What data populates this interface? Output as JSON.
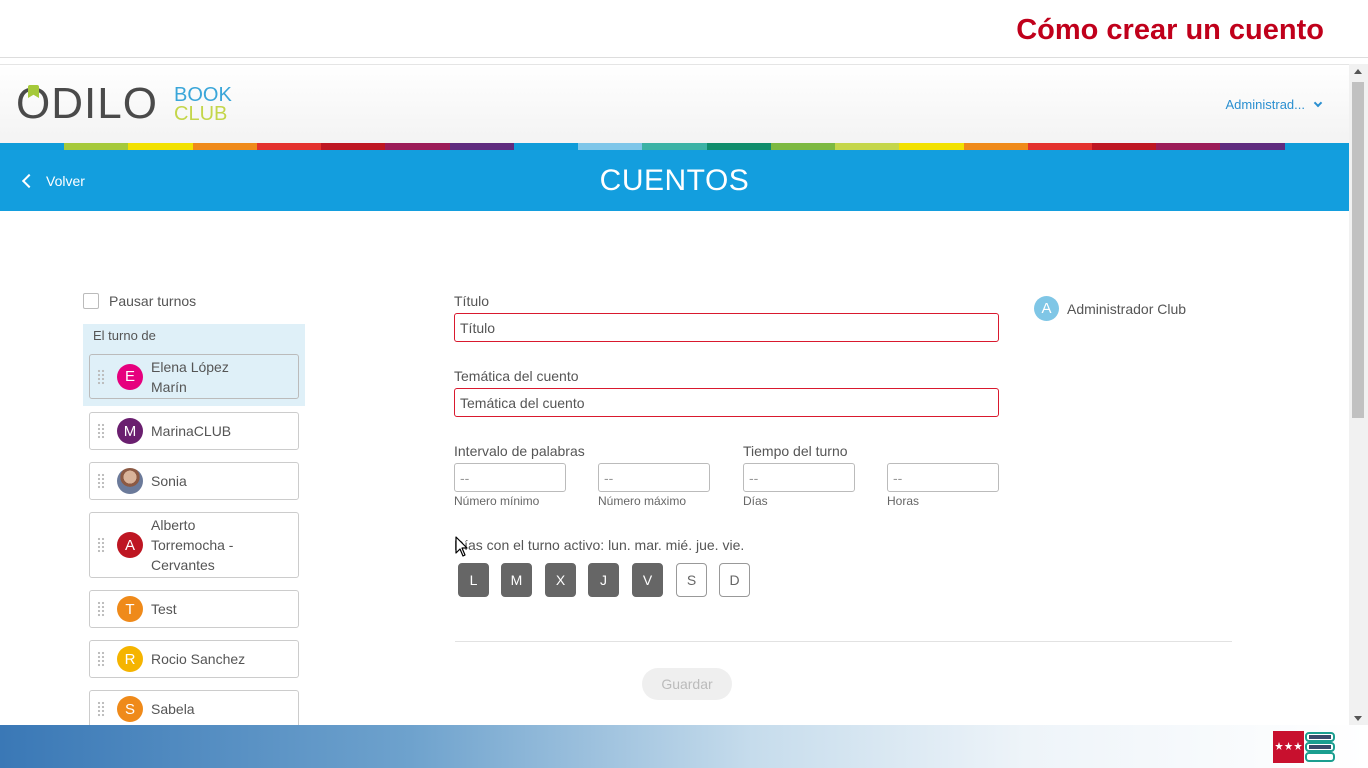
{
  "video_title": "Cómo crear un cuento",
  "header": {
    "logo_main": "ODILO",
    "logo_book": "BOOK",
    "logo_club": "CLUB",
    "user_menu": "Administrad..."
  },
  "stripe_colors": [
    "#0e9cd9",
    "#a5c93a",
    "#f2e100",
    "#ef8a1a",
    "#e3312d",
    "#be1622",
    "#9b1b58",
    "#5e2b7e",
    "#0e9cd9",
    "#7ec6e9",
    "#3bb2a5",
    "#0f8c6b",
    "#7cb941",
    "#c4d64a",
    "#f2e100",
    "#ef8a1a",
    "#e3312d",
    "#be1622",
    "#9b1b58",
    "#5e2b7e",
    "#0e9cd9"
  ],
  "banner": {
    "back_label": "Volver",
    "title": "CUENTOS"
  },
  "sidebar": {
    "pause_label": "Pausar turnos",
    "turn_label": "El turno de",
    "members": [
      {
        "initial": "E",
        "name": "Elena López Marín",
        "color": "#e6007e"
      },
      {
        "initial": "M",
        "name": "MarinaCLUB",
        "color": "#6a1f6f"
      },
      {
        "initial": "",
        "name": "Sonia",
        "color": "#8c5a44"
      },
      {
        "initial": "A",
        "name": "Alberto Torremocha - Cervantes",
        "color": "#be1622"
      },
      {
        "initial": "T",
        "name": "Test",
        "color": "#ef8a1a"
      },
      {
        "initial": "R",
        "name": "Rocio Sanchez",
        "color": "#f5b400"
      },
      {
        "initial": "S",
        "name": "Sabela",
        "color": "#ef8a1a"
      }
    ]
  },
  "form": {
    "title_label": "Título",
    "title_placeholder": "Título",
    "theme_label": "Temática del cuento",
    "theme_placeholder": "Temática del cuento",
    "interval_label": "Intervalo de palabras",
    "turn_time_label": "Tiempo del turno",
    "min_value": "--",
    "max_value": "--",
    "days_value": "--",
    "hours_value": "--",
    "min_label": "Número mínimo",
    "max_label": "Número máximo",
    "days_label": "Días",
    "hours_label": "Horas",
    "active_days_text": "Días con el turno activo: lun. mar. mié. jue. vie.",
    "day_buttons": [
      {
        "label": "L",
        "active": true
      },
      {
        "label": "M",
        "active": true
      },
      {
        "label": "X",
        "active": true
      },
      {
        "label": "J",
        "active": true
      },
      {
        "label": "V",
        "active": true
      },
      {
        "label": "S",
        "active": false
      },
      {
        "label": "D",
        "active": false
      }
    ],
    "save_label": "Guardar"
  },
  "admin": {
    "initial": "A",
    "name": "Administrador Club"
  },
  "icons": {
    "back": "chevron-left-icon",
    "user_menu": "chevron-down-icon",
    "drag": "drag-handle-icon",
    "footer_logo": "comunidad-madrid-logo"
  }
}
